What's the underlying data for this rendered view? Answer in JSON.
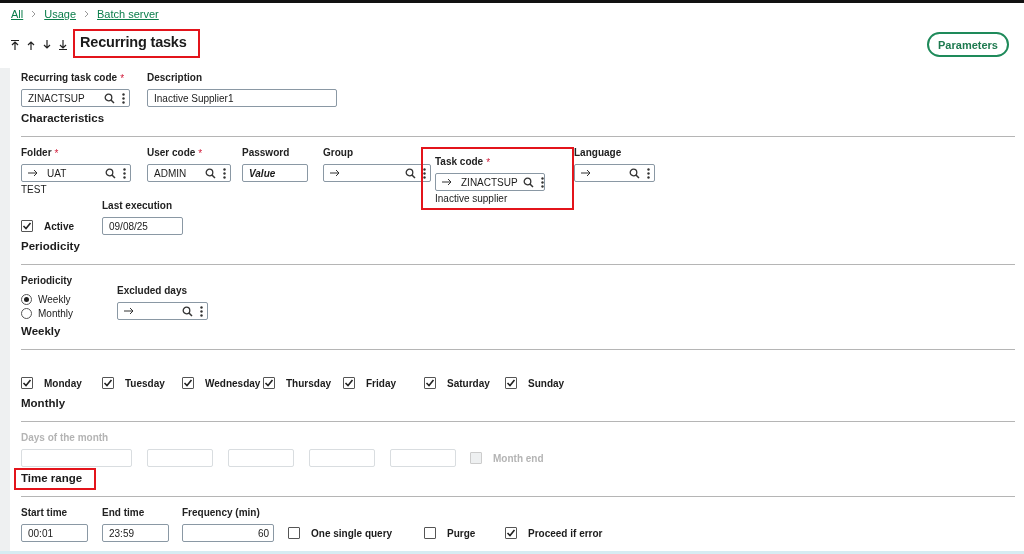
{
  "breadcrumb": [
    {
      "label": "All"
    },
    {
      "label": "Usage"
    },
    {
      "label": "Batch server"
    }
  ],
  "title": {
    "text": "Recurring tasks",
    "highlighted": true
  },
  "parameters_button": {
    "label": "Parameters"
  },
  "header_rows": [
    {
      "items": [
        {
          "kind": "lookup",
          "label": "Recurring task code",
          "required_mark": "*",
          "value": "ZINACTSUP",
          "arrow": false
        },
        {
          "kind": "text",
          "label": "Description",
          "value": "Inactive Supplier1"
        }
      ]
    }
  ],
  "sections": [
    {
      "heading": "Characteristics",
      "highlighted": false,
      "rows": [
        {
          "items": [
            {
              "kind": "lookup",
              "label": "Folder",
              "required_mark": "*",
              "value": "UAT",
              "arrow": true,
              "note": "TEST"
            },
            {
              "kind": "lookup",
              "label": "User code",
              "required_mark": "*",
              "value": "ADMIN",
              "arrow": false
            },
            {
              "kind": "password",
              "label": "Password",
              "value": "Value"
            },
            {
              "kind": "lookup",
              "label": "Group",
              "arrow": true
            },
            {
              "kind": "lookup",
              "label": "Task code",
              "required_mark": "*",
              "value": "ZINACTSUP",
              "arrow": true,
              "note": "Inactive supplier",
              "highlighted": true
            },
            {
              "kind": "lookup",
              "label": "Language",
              "arrow": true
            }
          ]
        },
        {
          "items": [
            {
              "kind": "checkbox",
              "label": "Active",
              "checked": true
            },
            {
              "kind": "text",
              "label": "Last execution",
              "value": "09/08/25"
            }
          ]
        }
      ]
    },
    {
      "heading": "Periodicity",
      "highlighted": false,
      "rows": [
        {
          "items": [
            {
              "kind": "radio_group",
              "label": "Periodicity",
              "options": [
                {
                  "label": "Weekly",
                  "selected": true
                },
                {
                  "label": "Monthly",
                  "selected": false
                }
              ]
            },
            {
              "kind": "lookup",
              "label": "Excluded days",
              "arrow": true
            }
          ]
        }
      ]
    },
    {
      "heading": "Weekly",
      "highlighted": false,
      "rows": [
        {
          "items": [
            {
              "kind": "checkbox",
              "label": "Monday",
              "checked": true
            },
            {
              "kind": "checkbox",
              "label": "Tuesday",
              "checked": true
            },
            {
              "kind": "checkbox",
              "label": "Wednesday",
              "checked": true
            },
            {
              "kind": "checkbox",
              "label": "Thursday",
              "checked": true
            },
            {
              "kind": "checkbox",
              "label": "Friday",
              "checked": true
            },
            {
              "kind": "checkbox",
              "label": "Saturday",
              "checked": true
            },
            {
              "kind": "checkbox",
              "label": "Sunday",
              "checked": true
            }
          ]
        }
      ]
    },
    {
      "heading": "Monthly",
      "highlighted": false,
      "rows": [
        {
          "items": [
            {
              "kind": "text",
              "label": "Days of the month",
              "disabled": true
            },
            {
              "kind": "text",
              "disabled": true
            },
            {
              "kind": "text",
              "disabled": true
            },
            {
              "kind": "text",
              "disabled": true
            },
            {
              "kind": "text",
              "disabled": true
            },
            {
              "kind": "checkbox",
              "label": "Month end",
              "checked": false,
              "disabled": true
            }
          ]
        }
      ]
    },
    {
      "heading": "Time range",
      "highlighted": true,
      "rows": [
        {
          "items": [
            {
              "kind": "text",
              "label": "Start time",
              "value": "00:01"
            },
            {
              "kind": "text",
              "label": "End time",
              "value": "23:59"
            },
            {
              "kind": "number",
              "label": "Frequency (min)",
              "value": "60"
            },
            {
              "kind": "checkbox",
              "label": "One single query",
              "checked": false
            },
            {
              "kind": "checkbox",
              "label": "Purge",
              "checked": false
            },
            {
              "kind": "checkbox",
              "label": "Proceed if error",
              "checked": true
            }
          ]
        }
      ]
    }
  ]
}
